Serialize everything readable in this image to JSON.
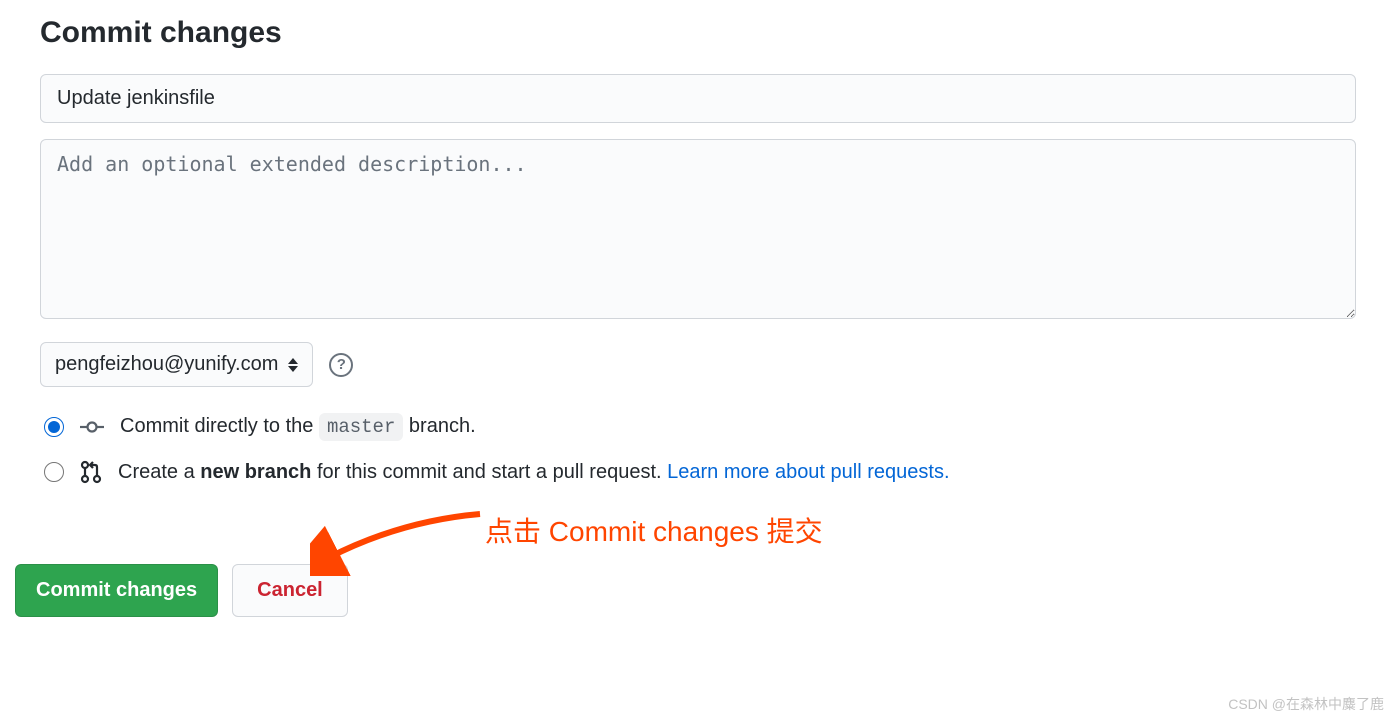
{
  "header": {
    "title": "Commit changes"
  },
  "form": {
    "summary_value": "Update jenkinsfile",
    "description_placeholder": "Add an optional extended description...",
    "email_selected": "pengfeizhou@yunify.com",
    "help_glyph": "?"
  },
  "radio": {
    "direct": {
      "prefix": "Commit directly to the ",
      "branch": "master",
      "suffix": " branch."
    },
    "new_branch": {
      "t1": "Create a ",
      "t2": "new branch",
      "t3": " for this commit and start a pull request. ",
      "learn": "Learn more about pull requests."
    }
  },
  "annotation": {
    "text": "点击 Commit changes 提交"
  },
  "buttons": {
    "commit": "Commit changes",
    "cancel": "Cancel"
  },
  "watermark": "CSDN @在森林中麋了鹿"
}
